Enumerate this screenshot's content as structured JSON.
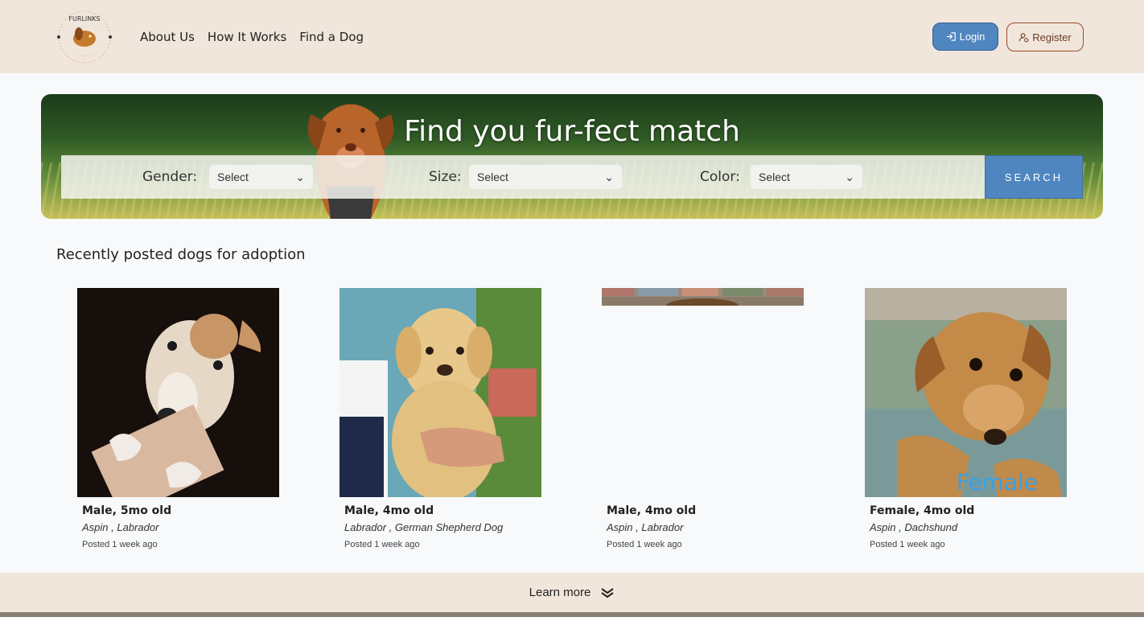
{
  "nav": {
    "links": [
      "About Us",
      "How It Works",
      "Find a Dog"
    ],
    "login_label": "Login",
    "register_label": "Register"
  },
  "hero": {
    "title": "Find you fur-fect match",
    "filters": {
      "gender": {
        "label": "Gender:",
        "value": "Select"
      },
      "size": {
        "label": "Size:",
        "value": "Select"
      },
      "color": {
        "label": "Color:",
        "value": "Select"
      }
    },
    "search_label": "SEARCH"
  },
  "recent": {
    "title": "Recently posted dogs for adoption",
    "dogs": [
      {
        "title": "Male, 5mo old",
        "breeds": "Aspin , Labrador",
        "posted": "Posted 1 week ago",
        "overlay": ""
      },
      {
        "title": "Male, 4mo old",
        "breeds": "Labrador , German Shepherd Dog",
        "posted": "Posted 1 week ago",
        "overlay": ""
      },
      {
        "title": "Male, 4mo old",
        "breeds": "Aspin , Labrador",
        "posted": "Posted 1 week ago",
        "overlay": ""
      },
      {
        "title": "Female, 4mo old",
        "breeds": "Aspin , Dachshund",
        "posted": "Posted 1 week ago",
        "overlay": "Female"
      }
    ]
  },
  "footer": {
    "learn_more": "Learn more"
  },
  "colors": {
    "nav_bg": "#f1e6db",
    "primary": "#4f86bf",
    "register_border": "#9a4a2a"
  }
}
